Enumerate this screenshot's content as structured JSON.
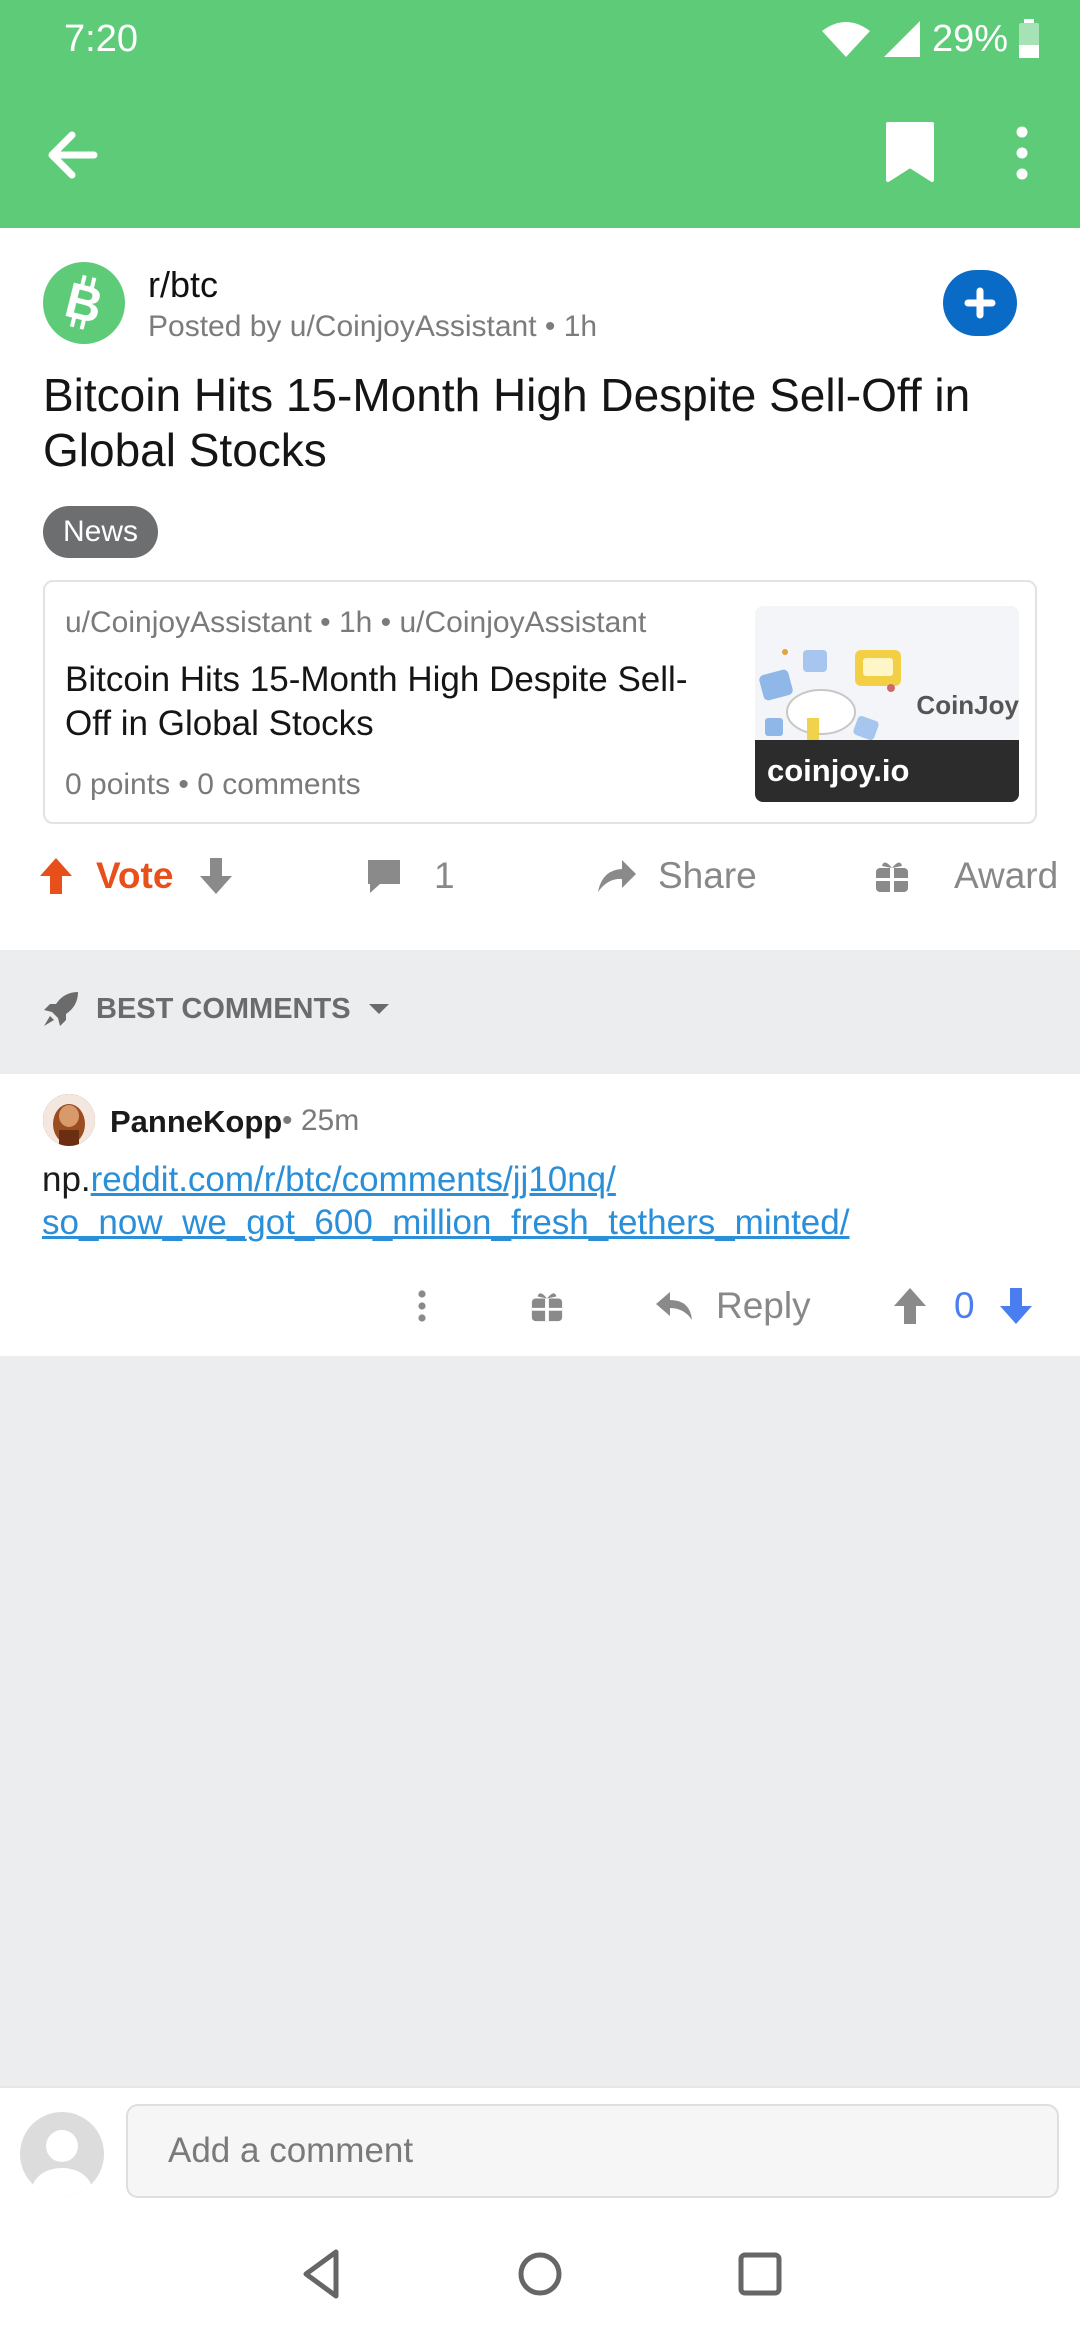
{
  "status_bar": {
    "time": "7:20",
    "battery": "29%"
  },
  "post": {
    "subreddit": "r/btc",
    "meta": "Posted by u/CoinjoyAssistant • 1h",
    "title": "Bitcoin Hits 15-Month High Despite Sell-Off in Global Stocks",
    "flair": "News",
    "link_card": {
      "meta": "u/CoinjoyAssistant • 1h • u/CoinjoyAssistant",
      "title": "Bitcoin Hits 15-Month High Despite Sell-Off in Global Stocks",
      "stats": "0 points • 0 comments",
      "thumb_brand": "CoinJoy",
      "domain": "coinjoy.io"
    },
    "actions": {
      "vote": "Vote",
      "comments": "1",
      "share": "Share",
      "award": "Award"
    }
  },
  "sort": {
    "label": "BEST COMMENTS"
  },
  "comment": {
    "author": "PanneKopp",
    "time": "• 25m",
    "body_prefix": "np.",
    "link_line1": "reddit.com/r/btc/comments/jj10nq/",
    "link_line2": "so_now_we_got_600_million_fresh_tethers_minted/",
    "reply": "Reply",
    "score": "0"
  },
  "composer": {
    "placeholder": "Add a comment"
  },
  "colors": {
    "app_bar": "#5ecb78",
    "join": "#0a6bc7",
    "upvote": "#e8501b",
    "downvote_active": "#4a7ef0",
    "link": "#2a8fd8"
  }
}
